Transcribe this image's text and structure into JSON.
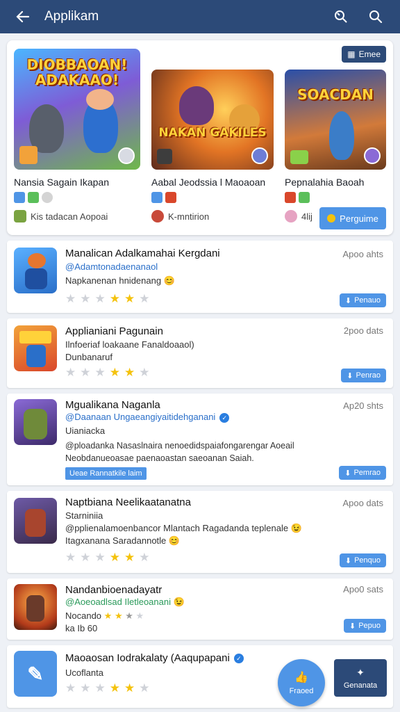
{
  "header": {
    "title": "Applikam",
    "icons": [
      "back-arrow-icon",
      "refresh-search-icon",
      "search-icon"
    ]
  },
  "featured": {
    "chip_label": "Emee",
    "button_label": "Perguime",
    "items": [
      {
        "art_text": "DIOBBAOAN! ADAKAAO!",
        "name": "Nansia Sagain Ikapan",
        "sub": "Kis tadacan Aopoai"
      },
      {
        "art_text": "NAKAN GAKILES",
        "name": "Aabal Jeodssia l Maoaoan",
        "sub": "K-mntirion"
      },
      {
        "art_text": "SOACDAN",
        "name": "Pepnalahia Baoah",
        "sub": "4lij"
      }
    ]
  },
  "list": [
    {
      "title": "Manalican Adalkamahai Kergdani",
      "handle": "@Adamtonadaenanaol",
      "desc": "Napkanenan hnidenang",
      "date": "Apoo ahts",
      "rating": 2,
      "button": "Penauo"
    },
    {
      "title": "Applianiani Pagunain",
      "line2": "Ilnfoeriaf loakaane Fanaldoaaol)",
      "line3": "Dunbanaruf",
      "date": "2poo dats",
      "rating": 2,
      "button": "Penrao"
    },
    {
      "title": "Mgualikana Naganla",
      "handle": "@Daanaan Ungaeangiyaitidehganani",
      "line2": "Uianiacka",
      "line3": "@ploadanka Nasaslnaira nenoedidspaiafongarengar Aoeail",
      "line4": "Neobdanueoasae paenaoastan saeoanan Saiah.",
      "tag": "Ueae Rannatkile laim",
      "date": "Ap20 shts",
      "button": "Pemrao"
    },
    {
      "title": "Naptbiana Neelikaatanatna",
      "line2": "Starniniia",
      "line3": "@pplienalamoenbancor Mlantach Ragadanda teplenale",
      "line4": "Itagxanana Saradannotle",
      "date": "Apoo dats",
      "rating": 2,
      "button": "Penquo"
    },
    {
      "title": "Nandanbioenadayatr",
      "handle": "@Aoeoadlsad Iletleoanani",
      "line2": "Nocando",
      "line3": "ka Ib 60",
      "date": "Apo0 sats",
      "button": "Pepuo"
    },
    {
      "title": "Maoaosan Iodrakalaty (Aaqupapani",
      "line2": "Ucoflanta",
      "date": "",
      "rating": 2
    }
  ],
  "fab": {
    "round_label": "Fraoed",
    "square_label": "Genanata"
  },
  "colors": {
    "header": "#2c4a78",
    "accent": "#4f95e6",
    "star": "#f4c20d"
  }
}
